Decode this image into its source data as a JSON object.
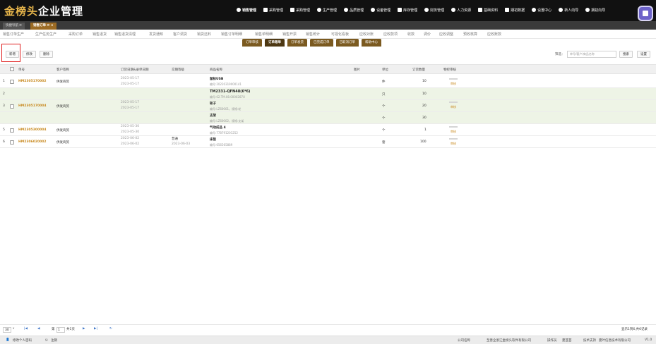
{
  "header": {
    "logo_gold": "金榜头",
    "logo_white": "企业管理",
    "nav": [
      {
        "label": "销售管理",
        "active": true
      },
      {
        "label": "采购管理"
      },
      {
        "label": "采购管理"
      },
      {
        "label": "生产管理"
      },
      {
        "label": "品质管理"
      },
      {
        "label": "设备管理"
      },
      {
        "label": "库存管理"
      },
      {
        "label": "财务管理"
      },
      {
        "label": "人力资源"
      },
      {
        "label": "基础资料"
      },
      {
        "label": "期初数据"
      },
      {
        "label": "设置中心"
      },
      {
        "label": "新人向导"
      },
      {
        "label": "期初向导"
      }
    ]
  },
  "tabs": [
    {
      "label": "快捷导航 ⟳"
    },
    {
      "label": "销售订单 ⟳ ×",
      "active": true
    }
  ],
  "submenu": [
    "销售订单生产",
    "生产任务生产",
    "采购订单",
    "销售退货",
    "销售退货清理",
    "发货通知",
    "客户调货",
    "销货还料",
    "销售订单明细",
    "销售单明细",
    "销售开票",
    "销售统计",
    "可视化看板",
    "应收对账",
    "应收款项",
    "收款",
    "调价",
    "应收调整",
    "预收核算",
    "应收账款"
  ],
  "status_tabs": [
    {
      "label": "订单审核"
    },
    {
      "label": "订单跟单",
      "active": true
    },
    {
      "label": "订单发货"
    },
    {
      "label": "已完成订单"
    },
    {
      "label": "已取消订单"
    },
    {
      "label": "帮助中心"
    }
  ],
  "toolbar": {
    "new_label": "新增",
    "edit_label": "修改",
    "delete_label": "删除",
    "filter_label": "筛选：",
    "search_placeholder": "单号/客户/商品名称",
    "search_button": "搜索",
    "settings_button": "设置"
  },
  "table": {
    "headers": {
      "order_no": "单号",
      "customer": "客户签称",
      "dates": "订货日期&录单日期",
      "level": "交期等级",
      "product": "商品名称",
      "image": "图片",
      "unit": "单位",
      "qty": "订货数量",
      "status": "物控审核"
    },
    "rows": [
      {
        "n": "1",
        "order_no": "HM2305170002",
        "customer": "供发商贸",
        "date1": "2023-05-17",
        "date2": "2023-05-17",
        "level": "",
        "level_date": "",
        "pname": "鼠标USB",
        "pcode": "编号:20220319000141",
        "unit": "件",
        "qty": "10",
        "status": "审核"
      },
      {
        "n": "2",
        "pname": "TM2331-QFN48(6*6)",
        "pcode": "编号:02.TM.08.0000287U",
        "unit": "只",
        "qty": "10"
      },
      {
        "n": "3",
        "order_no": "HM2305170004",
        "customer": "供发商贸",
        "date1": "2023-05-17",
        "date2": "2023-05-17",
        "pname": "轮子",
        "pcode": "编号:LZ60001，规格:轮",
        "unit": "个",
        "qty": "20",
        "status": "审核"
      },
      {
        "n": "",
        "pname": "支架",
        "pcode": "编号:LZ60002，规格:支架",
        "unit": "个",
        "qty": "30"
      },
      {
        "n": "5",
        "order_no": "HM2305300004",
        "customer": "供发商贸",
        "date1": "2023-05-30",
        "date2": "2023-05-30",
        "pname": "气动成品 4",
        "pcode": "编号:778791201252",
        "unit": "个",
        "qty": "1",
        "status": "审核"
      },
      {
        "n": "6",
        "order_no": "HM2306020002",
        "customer": "供发商贸",
        "date1": "2023-06-02",
        "date2": "2023-06-02",
        "level": "普通",
        "level_date": "2023-06-03",
        "pname": "床垫",
        "pcode": "编号:656565889",
        "unit": "套",
        "qty": "100",
        "status": "审核"
      }
    ]
  },
  "pager": {
    "page_size": "30",
    "page_prefix": "第",
    "page_value": "1",
    "page_suffix": "共1页",
    "summary": "显示1到6,共6记录"
  },
  "statusbar": {
    "change_password": "修改个人密码",
    "logout": "注销",
    "company_label": "公司名称",
    "company_value": "至善企浙江金榜头软件有限公司",
    "operator_label": "操作员",
    "operator_value": "夏芸芸",
    "support_label": "技术支持",
    "support_value": "夏叶信息技术有限公司",
    "version": "V1.0"
  }
}
